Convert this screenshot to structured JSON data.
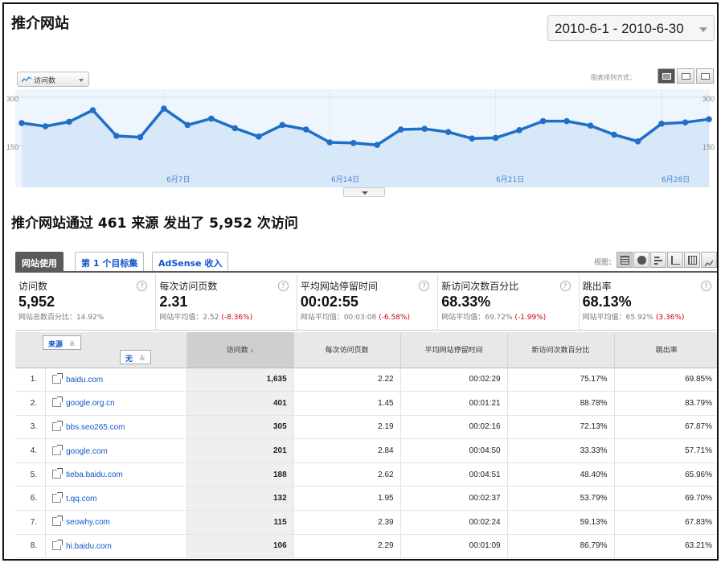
{
  "page": {
    "title": "推介网站",
    "date_range": "2010-6-1 - 2010-6-30"
  },
  "graph": {
    "metric_selector": "访问数",
    "chart_style_label": "图表排列方式：",
    "y_max_label": "300",
    "y_mid_label": "150",
    "date_labels": [
      "6月7日",
      "6月14日",
      "6月21日",
      "6月28日"
    ],
    "color": "#1f6fc9"
  },
  "chart_data": {
    "type": "area",
    "x": [
      "6/1",
      "6/2",
      "6/3",
      "6/4",
      "6/5",
      "6/6",
      "6/7",
      "6/8",
      "6/9",
      "6/10",
      "6/11",
      "6/12",
      "6/13",
      "6/14",
      "6/15",
      "6/16",
      "6/17",
      "6/18",
      "6/19",
      "6/20",
      "6/21",
      "6/22",
      "6/23",
      "6/24",
      "6/25",
      "6/26",
      "6/27",
      "6/28",
      "6/29",
      "6/30"
    ],
    "series": [
      {
        "values": [
          220,
          210,
          224,
          260,
          180,
          176,
          265,
          214,
          234,
          204,
          178,
          214,
          200,
          160,
          158,
          152,
          200,
          202,
          192,
          172,
          174,
          198,
          226,
          226,
          212,
          184,
          163,
          218,
          222,
          232
        ]
      }
    ],
    "ylim": [
      0,
      305
    ],
    "yticks": [
      150,
      300
    ],
    "grid": true
  },
  "summary": {
    "heading": "推介网站通过 461 来源 发出了 5,952 次访问"
  },
  "tabs": [
    {
      "label": "网站使用",
      "active": true
    },
    {
      "label": "第 1 个目标集",
      "active": false
    },
    {
      "label": "AdSense 收入",
      "active": false
    }
  ],
  "view": {
    "label": "视图："
  },
  "scorecard": [
    {
      "label": "访问数",
      "value": "5,952",
      "sub": "网站总数百分比：14.92%",
      "delta": ""
    },
    {
      "label": "每次访问页数",
      "value": "2.31",
      "sub": "网站平均值：2.52",
      "delta": "(-8.36%)"
    },
    {
      "label": "平均网站停留时间",
      "value": "00:02:55",
      "sub": "网站平均值：00:03:08",
      "delta": "(-6.58%)"
    },
    {
      "label": "新访问次数百分比",
      "value": "68.33%",
      "sub": "网站平均值：69.72%",
      "delta": "(-1.99%)"
    },
    {
      "label": "跳出率",
      "value": "68.13%",
      "sub": "网站平均值：65.92%",
      "delta": "(3.36%)"
    }
  ],
  "table": {
    "dim_source": "来源",
    "dim_none": "无",
    "columns": [
      "访问数 ↓",
      "每次访问页数",
      "平均网站停留时间",
      "新访问次数百分比",
      "跳出率"
    ],
    "rows": [
      {
        "idx": "1.",
        "source": "baidu.com",
        "visits": "1,635",
        "pages": "2.22",
        "time": "00:02:29",
        "new": "75.17%",
        "bounce": "69.85%"
      },
      {
        "idx": "2.",
        "source": "google.org.cn",
        "visits": "401",
        "pages": "1.45",
        "time": "00:01:21",
        "new": "88.78%",
        "bounce": "83.79%"
      },
      {
        "idx": "3.",
        "source": "bbs.seo265.com",
        "visits": "305",
        "pages": "2.19",
        "time": "00:02:16",
        "new": "72.13%",
        "bounce": "67.87%"
      },
      {
        "idx": "4.",
        "source": "google.com",
        "visits": "201",
        "pages": "2.84",
        "time": "00:04:50",
        "new": "33.33%",
        "bounce": "57.71%"
      },
      {
        "idx": "5.",
        "source": "tieba.baidu.com",
        "visits": "188",
        "pages": "2.62",
        "time": "00:04:51",
        "new": "48.40%",
        "bounce": "65.96%"
      },
      {
        "idx": "6.",
        "source": "t.qq.com",
        "visits": "132",
        "pages": "1.95",
        "time": "00:02:37",
        "new": "53.79%",
        "bounce": "69.70%"
      },
      {
        "idx": "7.",
        "source": "seowhy.com",
        "visits": "115",
        "pages": "2.39",
        "time": "00:02:24",
        "new": "59.13%",
        "bounce": "67.83%"
      },
      {
        "idx": "8.",
        "source": "hi.baidu.com",
        "visits": "106",
        "pages": "2.29",
        "time": "00:01:09",
        "new": "86.79%",
        "bounce": "63.21%"
      }
    ]
  }
}
